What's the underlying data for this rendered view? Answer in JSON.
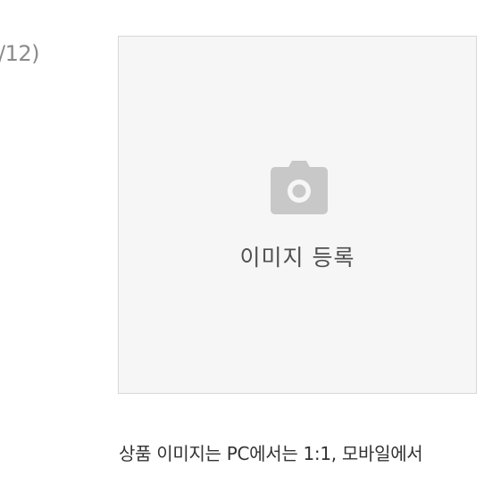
{
  "image_counter": {
    "text": "/12)"
  },
  "upload": {
    "icon": "camera-icon",
    "label": "이미지 등록",
    "icon_color": "#c8c8c8",
    "background_color": "#f6f6f6",
    "border_color": "#d7d7d7"
  },
  "guide": {
    "text": "상품 이미지는 PC에서는 1:1, 모바일에서"
  }
}
